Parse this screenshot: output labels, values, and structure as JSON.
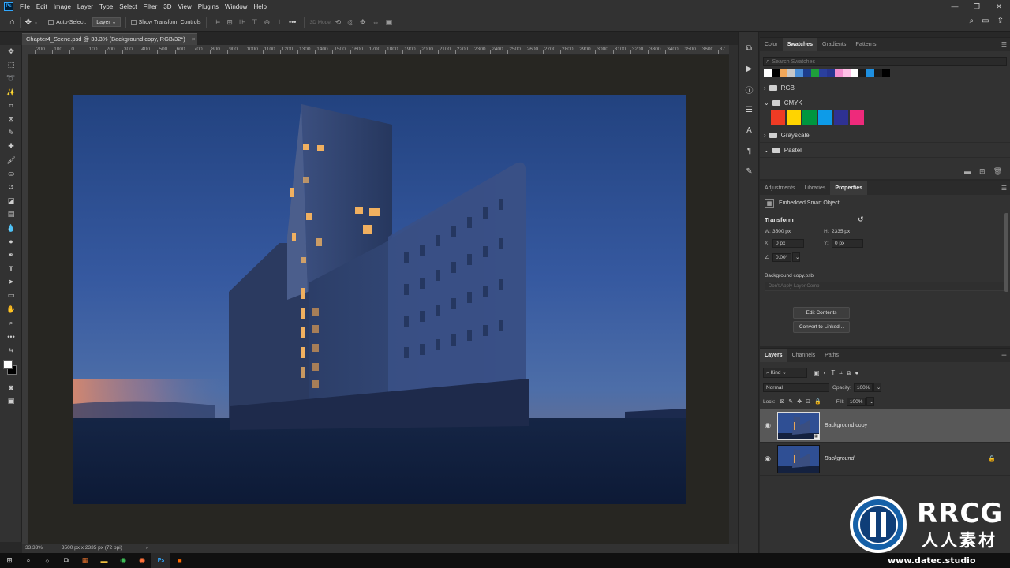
{
  "app": {
    "logo_text": "Ps"
  },
  "menu": [
    "File",
    "Edit",
    "Image",
    "Layer",
    "Type",
    "Select",
    "Filter",
    "3D",
    "View",
    "Plugins",
    "Window",
    "Help"
  ],
  "options_bar": {
    "auto_select_label": "Auto-Select:",
    "auto_select_target": "Layer",
    "show_transform_label": "Show Transform Controls",
    "mode_3d_label": "3D Mode:"
  },
  "document_tab": {
    "title": "Chapter4_Scene.psd @ 33.3% (Background copy, RGB/32*)",
    "close": "×"
  },
  "ruler_ticks": [
    "200",
    "100",
    "0",
    "100",
    "200",
    "300",
    "400",
    "500",
    "600",
    "700",
    "800",
    "900",
    "1000",
    "1100",
    "1200",
    "1300",
    "1400",
    "1500",
    "1600",
    "1700",
    "1800",
    "1900",
    "2000",
    "2100",
    "2200",
    "2300",
    "2400",
    "2500",
    "2600",
    "2700",
    "2800",
    "2900",
    "3000",
    "3100",
    "3200",
    "3300",
    "3400",
    "3500",
    "3600",
    "37"
  ],
  "status": {
    "zoom": "33.33%",
    "doc_info": "3500 px x 2335 px (72 ppi)",
    "arrow": "›"
  },
  "swatches_panel": {
    "tabs": [
      "Color",
      "Swatches",
      "Gradients",
      "Patterns"
    ],
    "active_tab": "Swatches",
    "search_placeholder": "Search Swatches",
    "recent_colors": [
      "#ffffff",
      "#000000",
      "#f2a85a",
      "#c8c8c8",
      "#4b8fd8",
      "#1d3d8c",
      "#1f9f3a",
      "#2a3f9d",
      "#26358f",
      "#f48fd0",
      "#ffc0e6",
      "#ffffff",
      "#1a1a1a",
      "#1e8fe0",
      "#1a1a1a",
      "#000000"
    ],
    "groups": [
      {
        "name": "RGB",
        "expanded": false
      },
      {
        "name": "CMYK",
        "expanded": true,
        "colors": [
          "#ef3b24",
          "#ffd400",
          "#00963f",
          "#0d9be8",
          "#2e3192",
          "#ee2a7b"
        ]
      },
      {
        "name": "Grayscale",
        "expanded": false
      },
      {
        "name": "Pastel",
        "expanded": true
      }
    ]
  },
  "properties_panel": {
    "tabs": [
      "Adjustments",
      "Libraries",
      "Properties"
    ],
    "active_tab": "Properties",
    "object_type": "Embedded Smart Object",
    "transform_heading": "Transform",
    "w_label": "W:",
    "w_value": "3500 px",
    "h_label": "H:",
    "h_value": "2335 px",
    "x_label": "X:",
    "x_value": "0 px",
    "y_label": "Y:",
    "y_value": "0 px",
    "angle_value": "0.00°",
    "source_file": "Background copy.psb",
    "layer_comp_placeholder": "Don't Apply Layer Comp",
    "edit_contents": "Edit Contents",
    "convert_linked": "Convert to Linked..."
  },
  "layers_panel": {
    "tabs": [
      "Layers",
      "Channels",
      "Paths"
    ],
    "active_tab": "Layers",
    "filter_kind": "Kind",
    "blend_mode": "Normal",
    "opacity_label": "Opacity:",
    "opacity_value": "100%",
    "lock_label": "Lock:",
    "fill_label": "Fill:",
    "fill_value": "100%",
    "layers": [
      {
        "name": "Background copy",
        "selected": true,
        "smart_object": true,
        "locked": false
      },
      {
        "name": "Background",
        "selected": false,
        "smart_object": false,
        "locked": true
      }
    ]
  },
  "watermark": {
    "brand": "RRCG",
    "subtitle": "人人素材",
    "url": "www.datec.studio"
  },
  "colors": {
    "accent": "#31a8ff",
    "panel": "#323232",
    "canvas_bg": "#272622",
    "sky_top": "#2b4d8f",
    "sky_bottom": "#4a6fb0",
    "ground": "#0f1a33"
  }
}
